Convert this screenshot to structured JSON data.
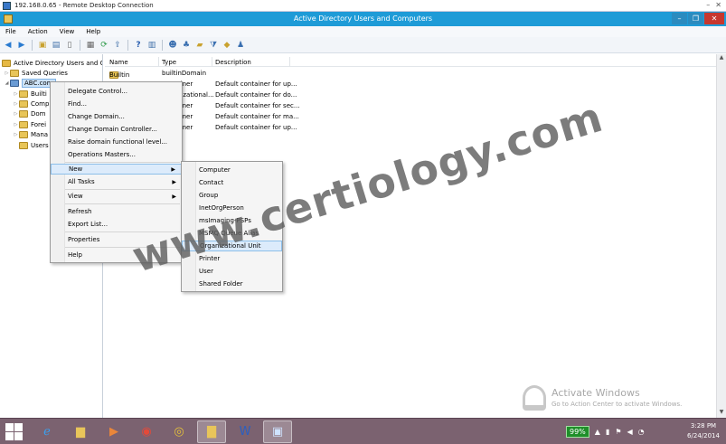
{
  "rdp": {
    "title": "192.168.0.65 - Remote Desktop Connection"
  },
  "window": {
    "title": "Active Directory Users and Computers"
  },
  "menubar": [
    "File",
    "Action",
    "View",
    "Help"
  ],
  "tree": {
    "root": "Active Directory Users and Com",
    "saved_queries": "Saved Queries",
    "domain": "ABC.com",
    "children": [
      "Builti",
      "Comp",
      "Dom",
      "Forei",
      "Mana",
      "Users"
    ]
  },
  "list": {
    "columns": [
      "Name",
      "Type",
      "Description"
    ],
    "rows": [
      {
        "name": "Builtin",
        "type": "builtinDomain",
        "desc": ""
      },
      {
        "name": "",
        "type": "Container",
        "desc": "Default container for up..."
      },
      {
        "name": "",
        "type": "Organizational...",
        "desc": "Default container for do..."
      },
      {
        "name": "",
        "type": "Container",
        "desc": "Default container for sec..."
      },
      {
        "name": "",
        "type": "Container",
        "desc": "Default container for ma..."
      },
      {
        "name": "",
        "type": "Container",
        "desc": "Default container for up..."
      }
    ]
  },
  "context_menu": {
    "items": [
      "Delegate Control...",
      "Find...",
      "Change Domain...",
      "Change Domain Controller...",
      "Raise domain functional level...",
      "Operations Masters..."
    ],
    "new": "New",
    "all_tasks": "All Tasks",
    "view": "View",
    "refresh": "Refresh",
    "export": "Export List...",
    "properties": "Properties",
    "help": "Help"
  },
  "submenu": {
    "items": [
      "Computer",
      "Contact",
      "Group",
      "InetOrgPerson",
      "msImaging-PSPs",
      "MSMQ Queue Alias",
      "Organizational Unit",
      "Printer",
      "User",
      "Shared Folder"
    ],
    "highlighted": "Organizational Unit"
  },
  "watermark": "www.certiology.com",
  "activate": {
    "line1": "Activate Windows",
    "line2": "Go to Action Center to activate Windows."
  },
  "taskbar": {
    "battery": "99%",
    "time": "3:28 PM",
    "date": "6/24/2014"
  }
}
